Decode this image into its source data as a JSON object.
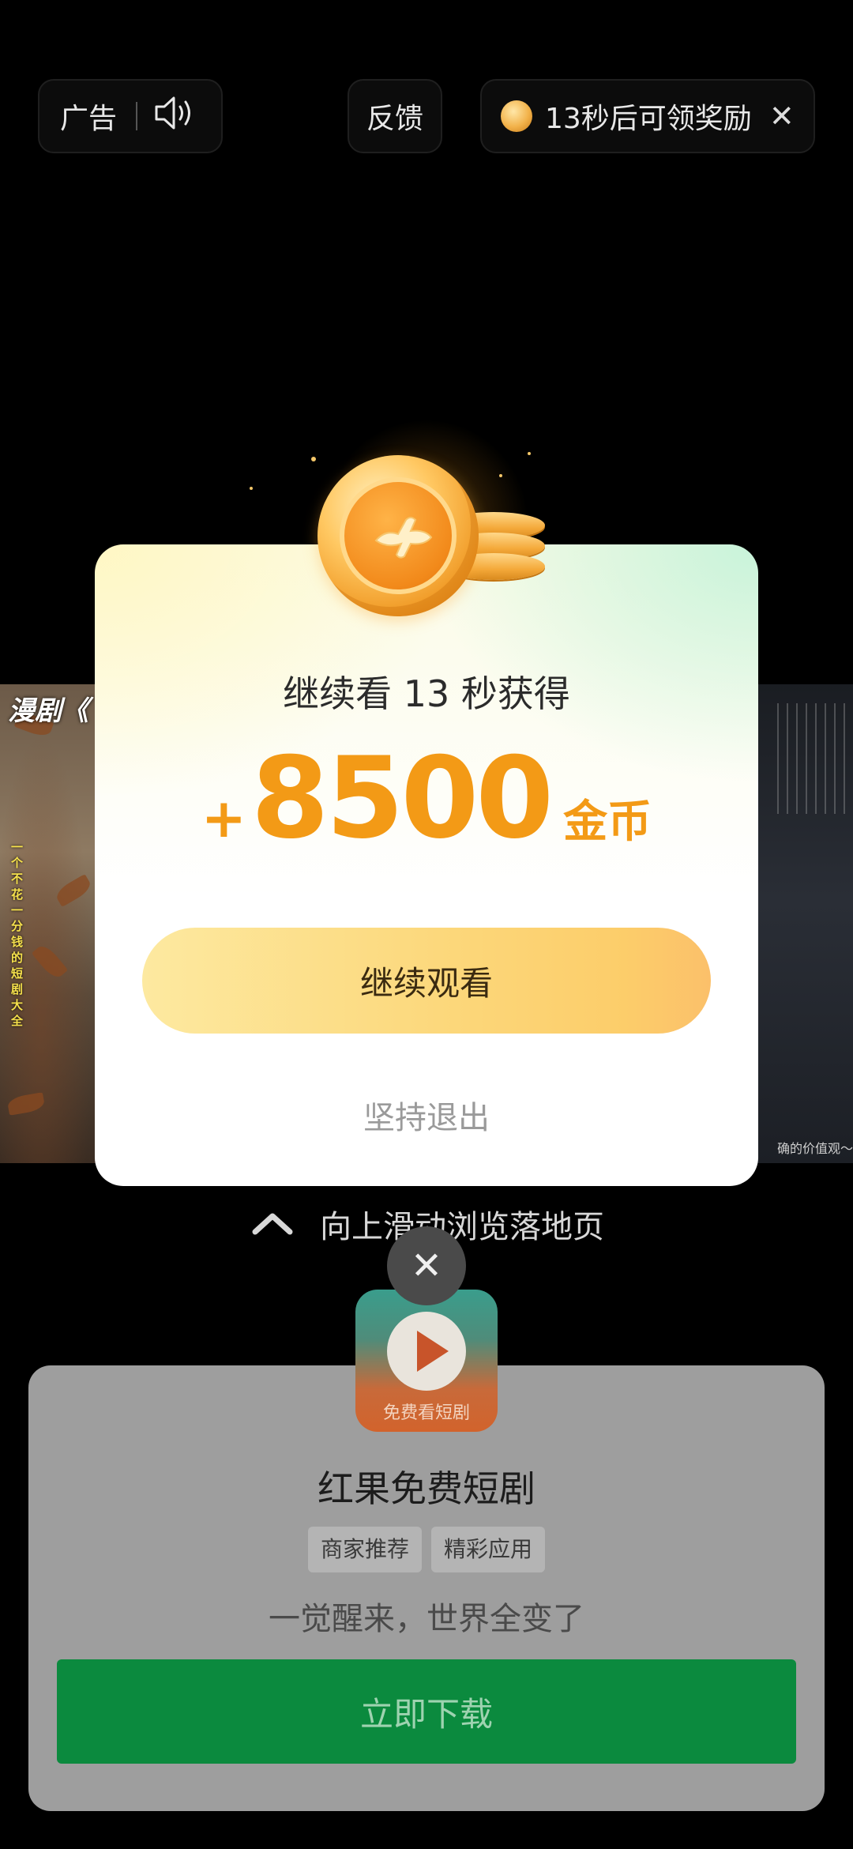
{
  "top_bar": {
    "ad_label": "广告",
    "feedback_label": "反馈",
    "reward_countdown": "13秒后可领奖励",
    "close_symbol": "✕",
    "icons": [
      "speaker-icon",
      "coin-icon",
      "close-icon"
    ]
  },
  "video": {
    "left_title": "漫剧《",
    "left_vertical_text": "一个不花一分钱的短剧大全",
    "right_caption": "确的价值观～"
  },
  "reward_dialog": {
    "subtitle": "继续看 13 秒获得",
    "amount_prefix": "+",
    "amount": "8500",
    "amount_unit": "金币",
    "continue_button": "继续观看",
    "quit_link": "坚持退出",
    "accent_color": "#f39a16"
  },
  "swipe_hint": {
    "text": "向上滑动浏览落地页"
  },
  "app_card": {
    "icon_label": "免费看短剧",
    "close_symbol": "✕",
    "app_name": "红果免费短剧",
    "tags": [
      "商家推荐",
      "精彩应用"
    ],
    "slogan": "一觉醒来，世界全变了",
    "download_button": "立即下载",
    "button_color": "#0b8a3e"
  }
}
